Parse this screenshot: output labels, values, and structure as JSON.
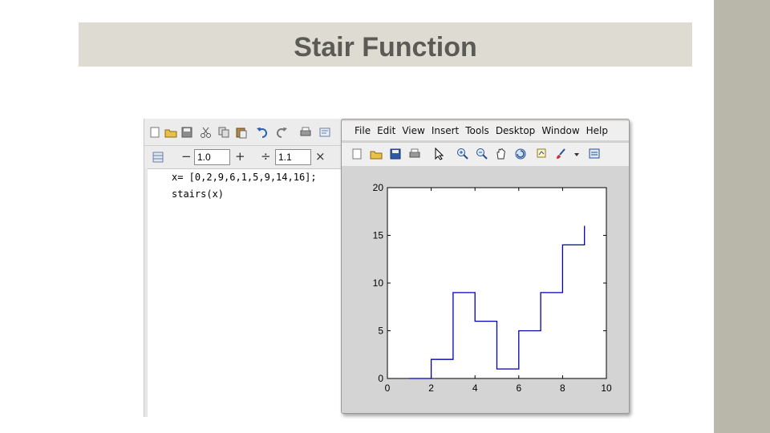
{
  "slide": {
    "title": "Stair Function"
  },
  "editor": {
    "toolbar2": {
      "minus_symbol": "−",
      "value1": "1.0",
      "plus_symbol": "+",
      "divide_symbol": "÷",
      "value2": "1.1",
      "times_symbol": "×"
    },
    "code_lines": [
      "x= [0,2,9,6,1,5,9,14,16];",
      "stairs(x)"
    ]
  },
  "figure": {
    "menu": [
      "File",
      "Edit",
      "View",
      "Insert",
      "Tools",
      "Desktop",
      "Window",
      "Help"
    ],
    "toolbar_icons": [
      "new-figure-icon",
      "open-file-icon",
      "save-icon",
      "print-icon",
      "arrow-select-icon",
      "zoom-in-icon",
      "zoom-out-icon",
      "pan-hand-icon",
      "rotate-3d-icon",
      "data-cursor-icon",
      "brush-icon",
      "dropdown-icon",
      "link-plot-icon"
    ]
  },
  "chart_data": {
    "type": "line",
    "subtype": "stairs",
    "x": [
      1,
      2,
      3,
      4,
      5,
      6,
      7,
      8,
      9
    ],
    "values": [
      0,
      2,
      9,
      6,
      1,
      5,
      9,
      14,
      16
    ],
    "xlim": [
      0,
      10
    ],
    "ylim": [
      0,
      20
    ],
    "xticks": [
      0,
      2,
      4,
      6,
      8,
      10
    ],
    "yticks": [
      0,
      5,
      10,
      15,
      20
    ],
    "title": "",
    "xlabel": "",
    "ylabel": "",
    "line_color": "#0000b4",
    "grid": false
  },
  "colors": {
    "sidebar": "#b9b6aa",
    "title_band": "#dedbd2",
    "title_text": "#5b5a55"
  }
}
